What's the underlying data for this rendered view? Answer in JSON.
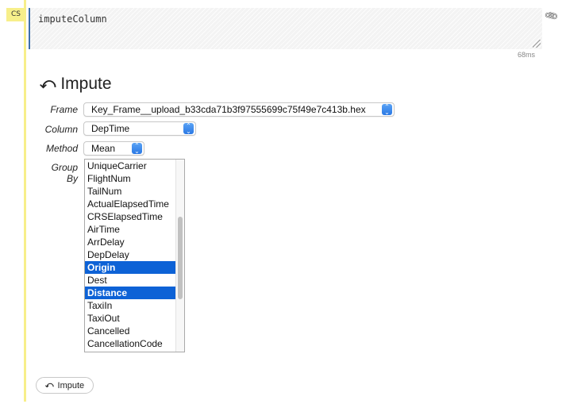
{
  "cell": {
    "type_badge": "CS",
    "code": "imputeColumn",
    "timing": "68ms",
    "clip_icon": "paperclip-icon"
  },
  "output": {
    "title": "Impute",
    "title_icon": "reply-all-icon",
    "form": {
      "frame": {
        "label": "Frame",
        "value": "Key_Frame__upload_b33cda71b3f97555699c75f49e7c413b.hex"
      },
      "column": {
        "label": "Column",
        "value": "DepTime"
      },
      "method": {
        "label": "Method",
        "value": "Mean"
      },
      "group_by": {
        "label": "Group By",
        "items": [
          {
            "label": "UniqueCarrier",
            "selected": false
          },
          {
            "label": "FlightNum",
            "selected": false
          },
          {
            "label": "TailNum",
            "selected": false
          },
          {
            "label": "ActualElapsedTime",
            "selected": false
          },
          {
            "label": "CRSElapsedTime",
            "selected": false
          },
          {
            "label": "AirTime",
            "selected": false
          },
          {
            "label": "ArrDelay",
            "selected": false
          },
          {
            "label": "DepDelay",
            "selected": false
          },
          {
            "label": "Origin",
            "selected": true
          },
          {
            "label": "Dest",
            "selected": false
          },
          {
            "label": "Distance",
            "selected": true
          },
          {
            "label": "TaxiIn",
            "selected": false
          },
          {
            "label": "TaxiOut",
            "selected": false
          },
          {
            "label": "Cancelled",
            "selected": false
          },
          {
            "label": "CancellationCode",
            "selected": false
          }
        ]
      }
    },
    "impute_button": {
      "label": "Impute",
      "icon": "reply-all-icon"
    }
  },
  "colors": {
    "cell_accent": "#f7ef8a",
    "editor_border": "#3d6fa8",
    "selection": "#0d62d6"
  }
}
